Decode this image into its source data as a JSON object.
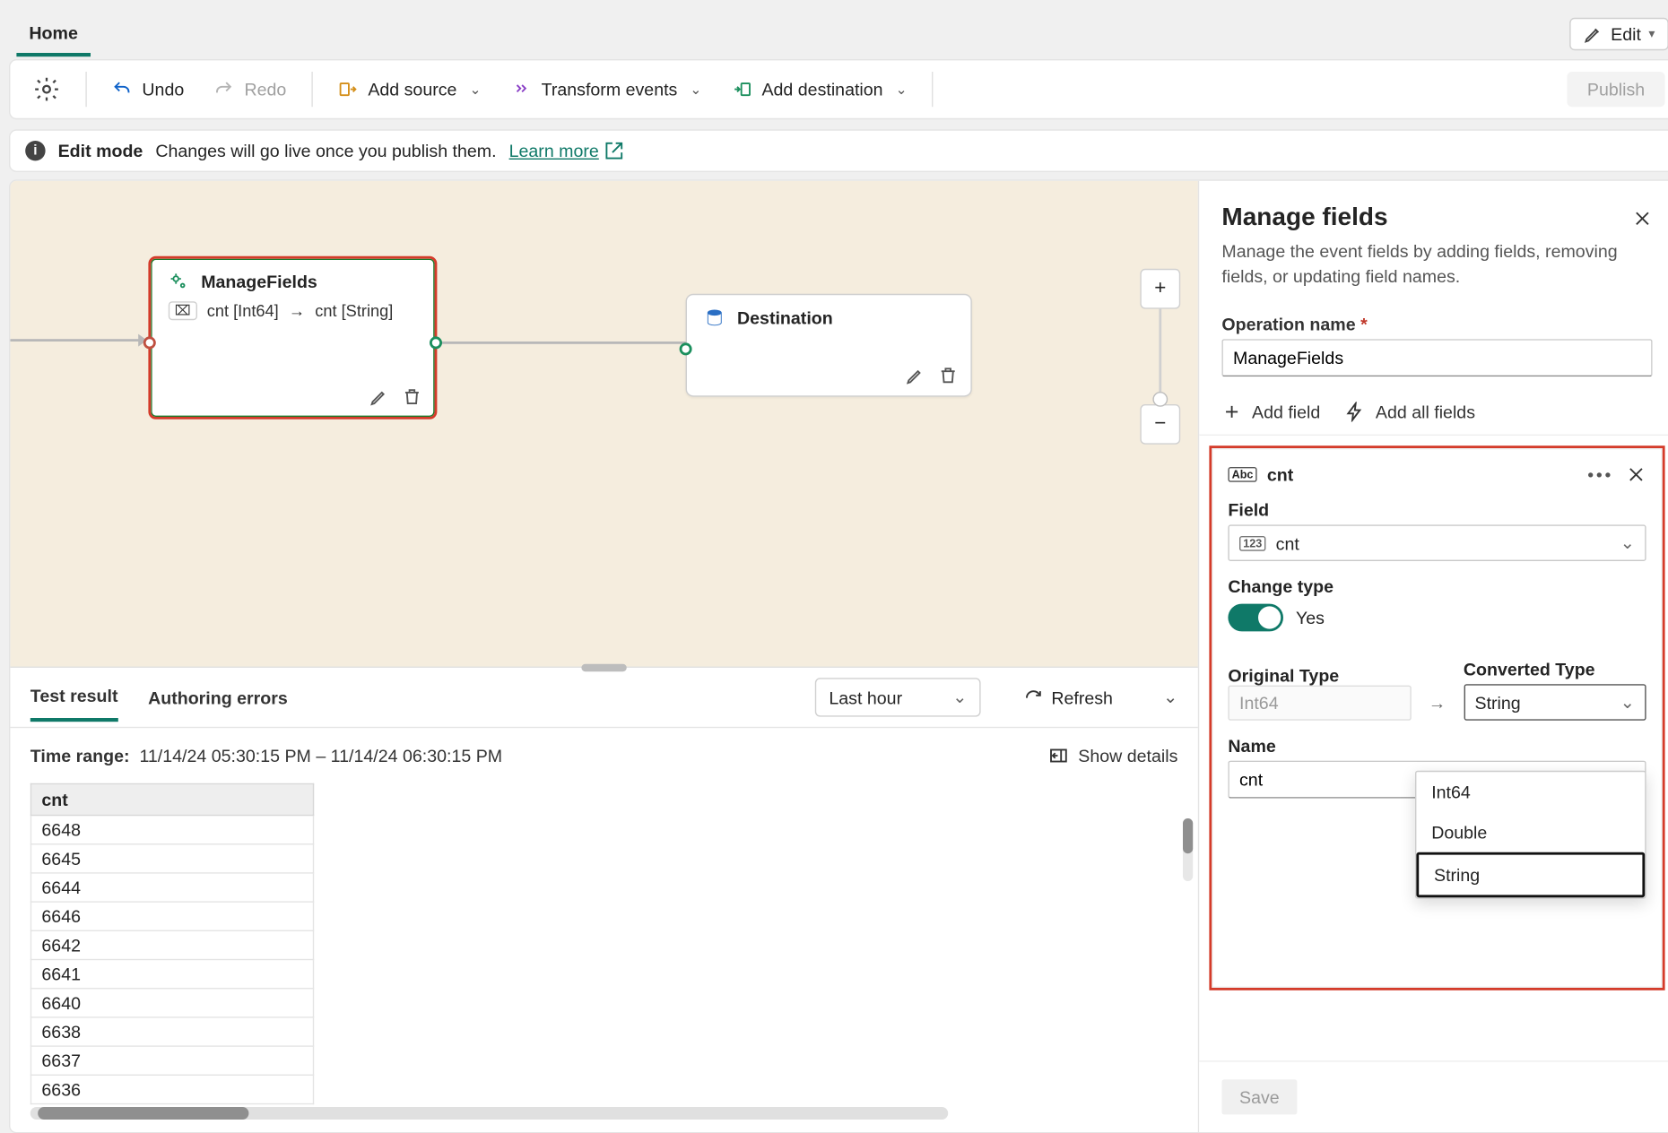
{
  "tabs": {
    "home": "Home",
    "edit_btn": "Edit"
  },
  "toolbar": {
    "undo": "Undo",
    "redo": "Redo",
    "add_source": "Add source",
    "transform": "Transform events",
    "add_dest": "Add destination",
    "publish": "Publish"
  },
  "banner": {
    "mode": "Edit mode",
    "msg": "Changes will go live once you publish them.",
    "learn": "Learn more"
  },
  "canvas": {
    "mf_title": "ManageFields",
    "mf_sub_l": "cnt [Int64]",
    "mf_sub_r": "cnt [String]",
    "dest_title": "Destination"
  },
  "results": {
    "tab_tr": "Test result",
    "tab_ae": "Authoring errors",
    "time_sel": "Last hour",
    "refresh": "Refresh",
    "tr_label": "Time range:",
    "tr_value": "11/14/24 05:30:15 PM  –  11/14/24 06:30:15 PM",
    "show_details": "Show details",
    "col": "cnt",
    "rows": [
      "6648",
      "6645",
      "6644",
      "6646",
      "6642",
      "6641",
      "6640",
      "6638",
      "6637",
      "6636"
    ]
  },
  "panel": {
    "title": "Manage fields",
    "sub": "Manage the event fields by adding fields, removing fields, or updating field names.",
    "op_label": "Operation name",
    "op_value": "ManageFields",
    "add_field": "Add field",
    "add_all": "Add all fields",
    "card_title": "cnt",
    "field_label": "Field",
    "field_value": "cnt",
    "change_type": "Change type",
    "yes": "Yes",
    "orig_label": "Original Type",
    "orig_value": "Int64",
    "conv_label": "Converted Type",
    "conv_value": "String",
    "name_label": "Name",
    "name_value": "cnt",
    "opts": [
      "Int64",
      "Double",
      "String"
    ],
    "save": "Save"
  }
}
